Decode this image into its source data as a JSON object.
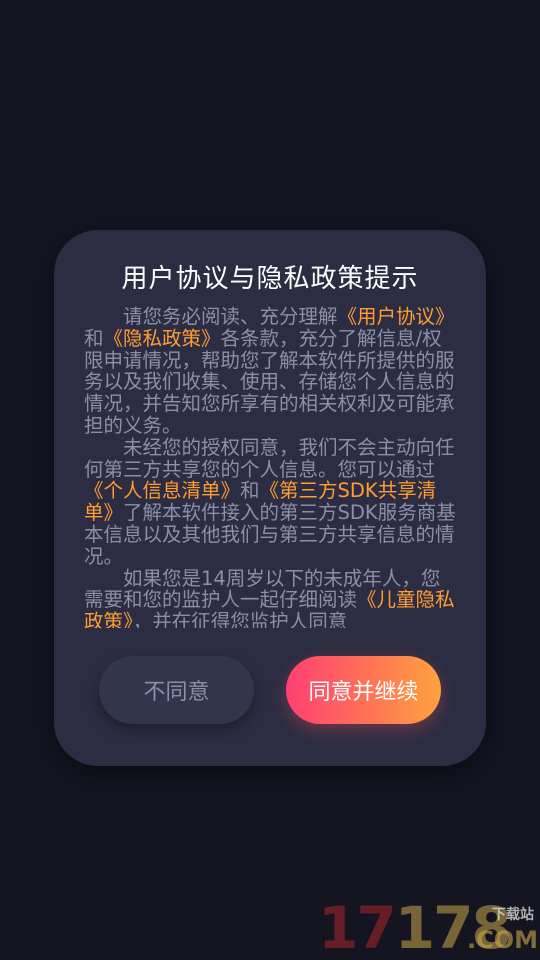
{
  "dialog": {
    "title": "用户协议与隐私政策提示",
    "p1": {
      "t1": "请您务必阅读、充分理解",
      "link_user_agreement": "《用户协议》",
      "t2": "和",
      "link_privacy_policy": "《隐私政策》",
      "t3": "各条款，充分了解信息/权限申请情况，帮助您了解本软件所提供的服务以及我们收集、使用、存储您个人信息的情况，并告知您所享有的相关权利及可能承担的义务。"
    },
    "p2": {
      "t1": "未经您的授权同意，我们不会主动向任何第三方共享您的个人信息。您可以通过",
      "link_personal_info_list": "《个人信息清单》",
      "t2": "和",
      "link_third_party_sdk": "《第三方SDK共享清单》",
      "t3": "了解本软件接入的第三方SDK服务商基本信息以及其他我们与第三方共享信息的情况。"
    },
    "p3": {
      "t1": "如果您是14周岁以下的未成年人，您需要和您的监护人一起仔细阅读",
      "link_child_privacy": "《儿童隐私政策》",
      "t2": "，并在征得您监护人同意"
    },
    "buttons": {
      "disagree": "不同意",
      "agree": "同意并继续"
    }
  },
  "watermark": {
    "num_part1": "17",
    "num_part2": "178",
    "label": "下载站",
    "domain": ".COM"
  },
  "colors": {
    "background": "#141520",
    "dialog": "#2c2d42",
    "link": "#ff9d33",
    "body_text": "#8d8fa8"
  }
}
